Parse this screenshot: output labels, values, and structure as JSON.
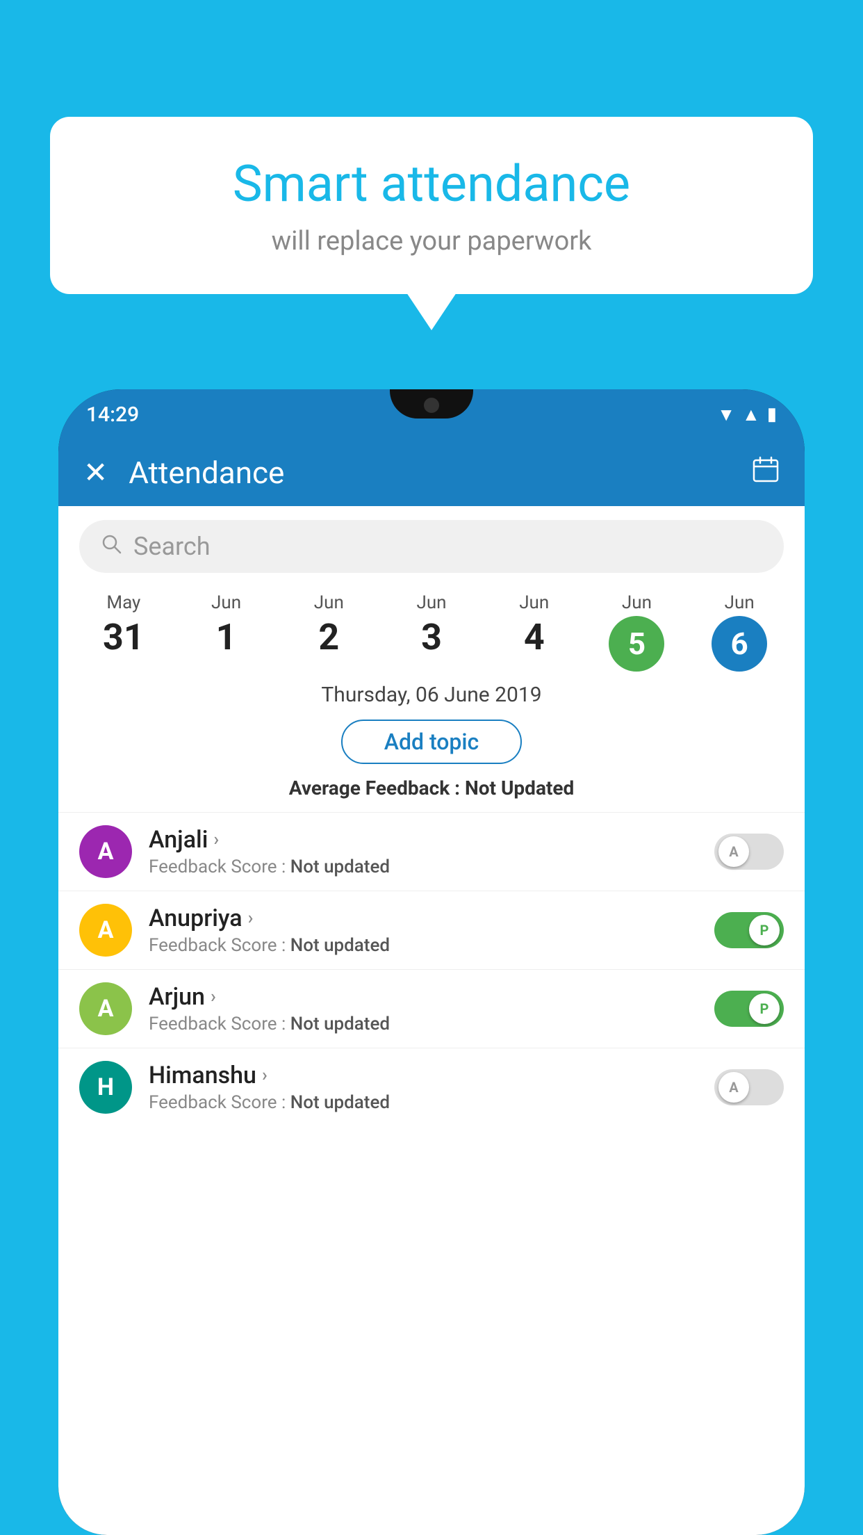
{
  "background": {
    "color": "#19b8e8"
  },
  "bubble": {
    "title": "Smart attendance",
    "subtitle": "will replace your paperwork"
  },
  "statusBar": {
    "time": "14:29",
    "icons": [
      "wifi",
      "signal",
      "battery"
    ]
  },
  "appBar": {
    "title": "Attendance",
    "closeLabel": "✕",
    "calendarLabel": "📅"
  },
  "search": {
    "placeholder": "Search"
  },
  "dates": [
    {
      "month": "May",
      "day": "31",
      "selected": ""
    },
    {
      "month": "Jun",
      "day": "1",
      "selected": ""
    },
    {
      "month": "Jun",
      "day": "2",
      "selected": ""
    },
    {
      "month": "Jun",
      "day": "3",
      "selected": ""
    },
    {
      "month": "Jun",
      "day": "4",
      "selected": ""
    },
    {
      "month": "Jun",
      "day": "5",
      "selected": "green"
    },
    {
      "month": "Jun",
      "day": "6",
      "selected": "blue"
    }
  ],
  "selectedDate": "Thursday, 06 June 2019",
  "addTopicLabel": "Add topic",
  "avgFeedback": {
    "label": "Average Feedback : ",
    "value": "Not Updated"
  },
  "students": [
    {
      "name": "Anjali",
      "avatarLetter": "A",
      "avatarColor": "av-purple",
      "feedback": "Feedback Score : ",
      "feedbackValue": "Not updated",
      "toggleState": "off",
      "toggleLabel": "A"
    },
    {
      "name": "Anupriya",
      "avatarLetter": "A",
      "avatarColor": "av-yellow",
      "feedback": "Feedback Score : ",
      "feedbackValue": "Not updated",
      "toggleState": "on-green",
      "toggleLabel": "P"
    },
    {
      "name": "Arjun",
      "avatarLetter": "A",
      "avatarColor": "av-lime",
      "feedback": "Feedback Score : ",
      "feedbackValue": "Not updated",
      "toggleState": "on-green",
      "toggleLabel": "P"
    },
    {
      "name": "Himanshu",
      "avatarLetter": "H",
      "avatarColor": "av-teal",
      "feedback": "Feedback Score : ",
      "feedbackValue": "Not updated",
      "toggleState": "off",
      "toggleLabel": "A"
    }
  ]
}
